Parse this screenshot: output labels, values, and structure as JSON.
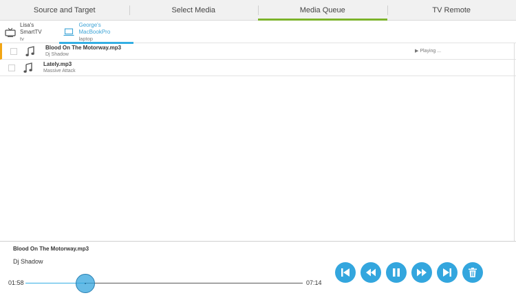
{
  "tabs": [
    {
      "label": "Source and Target"
    },
    {
      "label": "Select Media"
    },
    {
      "label": "Media Queue"
    },
    {
      "label": "TV Remote"
    }
  ],
  "devices": [
    {
      "name": "Lisa's SmartTV",
      "type": "tv",
      "icon": "tv-icon"
    },
    {
      "name": "George's MacBookPro",
      "type": "laptop",
      "icon": "laptop-icon"
    }
  ],
  "queue": [
    {
      "title": "Blood On The Motorway.mp3",
      "artist": "Dj Shadow",
      "status": "▶ Playing ...",
      "icon": "music-note-icon"
    },
    {
      "title": "Lately.mp3",
      "artist": "Massive Attack",
      "status": "",
      "icon": "music-note-icon"
    }
  ],
  "player": {
    "title": "Blood On The Motorway.mp3",
    "artist": "Dj Shadow",
    "elapsed": "01:58",
    "total": "07:14",
    "progress": 0.215
  },
  "controls": [
    {
      "name": "skip-previous-icon"
    },
    {
      "name": "rewind-icon"
    },
    {
      "name": "pause-icon"
    },
    {
      "name": "fast-forward-icon"
    },
    {
      "name": "skip-next-icon"
    },
    {
      "name": "trash-icon"
    }
  ],
  "colors": {
    "active_tab": "#7cb32a",
    "selected_device": "#33aee3",
    "current_row": "#f2a514",
    "control_button": "#33a6de"
  }
}
